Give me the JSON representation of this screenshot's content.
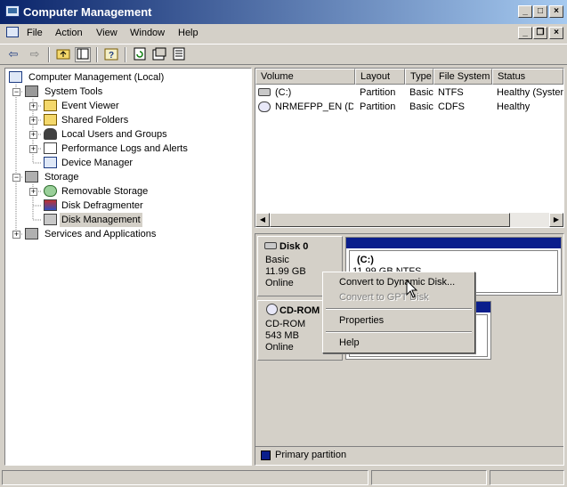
{
  "window": {
    "title": "Computer Management"
  },
  "menu": {
    "file": "File",
    "action": "Action",
    "view": "View",
    "window": "Window",
    "help": "Help"
  },
  "tree": {
    "root": "Computer Management (Local)",
    "system_tools": "System Tools",
    "event_viewer": "Event Viewer",
    "shared_folders": "Shared Folders",
    "local_users": "Local Users and Groups",
    "perf_logs": "Performance Logs and Alerts",
    "device_manager": "Device Manager",
    "storage": "Storage",
    "removable_storage": "Removable Storage",
    "disk_defrag": "Disk Defragmenter",
    "disk_management": "Disk Management",
    "services_apps": "Services and Applications"
  },
  "volume_list": {
    "columns": [
      "Volume",
      "Layout",
      "Type",
      "File System",
      "Status"
    ],
    "rows": [
      [
        "(C:)",
        "Partition",
        "Basic",
        "NTFS",
        "Healthy (System)"
      ],
      [
        "NRMEFPP_EN (D:)",
        "Partition",
        "Basic",
        "CDFS",
        "Healthy"
      ]
    ]
  },
  "disks": [
    {
      "name": "Disk 0",
      "type": "Basic",
      "size": "11.99 GB",
      "status": "Online",
      "volume_label": "(C:)",
      "volume_info": "11.99 GB NTFS"
    },
    {
      "name": "CD-ROM",
      "type": "CD-ROM",
      "size": "543 MB",
      "status": "Online"
    }
  ],
  "context_menu": {
    "convert_dynamic": "Convert to Dynamic Disk...",
    "convert_gpt": "Convert to GPT Disk",
    "properties": "Properties",
    "help": "Help"
  },
  "legend": {
    "primary_partition": "Primary partition",
    "primary_color": "#0a1e8c"
  }
}
